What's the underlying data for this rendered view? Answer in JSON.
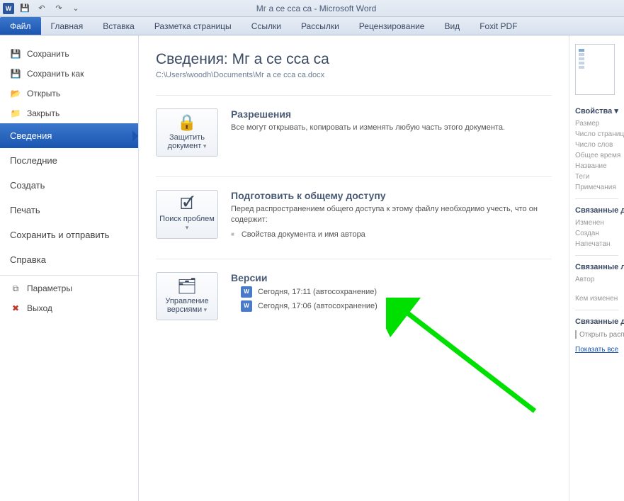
{
  "title": "Мг а се  сса са  -  Microsoft Word",
  "qat": {
    "save": "💾",
    "undo": "↶",
    "redo": "↷",
    "more": "⌄"
  },
  "tabs": [
    "Файл",
    "Главная",
    "Вставка",
    "Разметка страницы",
    "Ссылки",
    "Рассылки",
    "Рецензирование",
    "Вид",
    "Foxit PDF"
  ],
  "sidebar": {
    "top": [
      {
        "label": "Сохранить",
        "icon": "💾"
      },
      {
        "label": "Сохранить как",
        "icon": "💾"
      },
      {
        "label": "Открыть",
        "icon": "📂"
      },
      {
        "label": "Закрыть",
        "icon": "📁"
      }
    ],
    "mid": [
      {
        "label": "Сведения",
        "selected": true
      },
      {
        "label": "Последние"
      },
      {
        "label": "Создать"
      },
      {
        "label": "Печать"
      },
      {
        "label": "Сохранить и отправить"
      },
      {
        "label": "Справка"
      }
    ],
    "bottom": [
      {
        "label": "Параметры",
        "icon": "⧉"
      },
      {
        "label": "Выход",
        "icon": "✖"
      }
    ]
  },
  "content": {
    "heading": "Сведения: Мг а се  сса са",
    "path": "C:\\Users\\woodh\\Documents\\Мг а се  сса са.docx",
    "permissions": {
      "btn": "Защитить документ",
      "icon": "🔒",
      "title": "Разрешения",
      "text": "Все могут открывать, копировать и изменять любую часть этого документа."
    },
    "prepare": {
      "btn": "Поиск проблем",
      "icon": "🗹",
      "title": "Подготовить к общему доступу",
      "text": "Перед распространением общего доступа к этому файлу необходимо учесть, что он содержит:",
      "bullet": "Свойства документа и имя автора"
    },
    "versions": {
      "btn": "Управление версиями",
      "icon": "🗂",
      "title": "Версии",
      "items": [
        "Сегодня, 17:11 (автосохранение)",
        "Сегодня, 17:06 (автосохранение)"
      ]
    }
  },
  "rightpanel": {
    "props_head": "Свойства ▾",
    "rows1": [
      "Размер",
      "Число страниц",
      "Число слов",
      "Общее время",
      "Название",
      "Теги",
      "Примечания"
    ],
    "dates_head": "Связанные даты",
    "rows2": [
      "Изменен",
      "Создан",
      "Напечатан"
    ],
    "people_head": "Связанные люди",
    "rows3": [
      "Автор",
      "Кем изменен"
    ],
    "docs_head": "Связанные документы",
    "open_loc": "Открыть расположение",
    "show_all": "Показать все"
  }
}
